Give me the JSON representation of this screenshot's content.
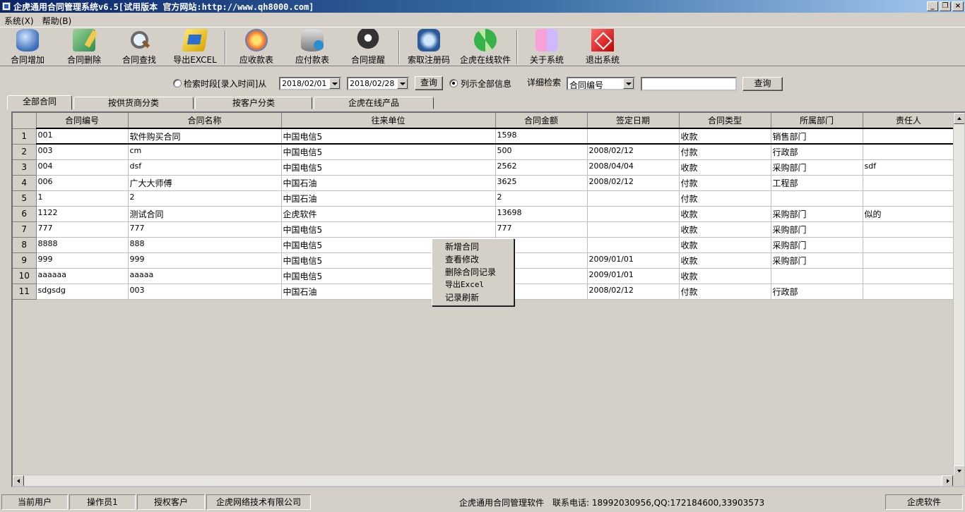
{
  "window": {
    "title": "企虎通用合同管理系统v6.5[试用版本 官方网站:http://www.qh8000.com]"
  },
  "menu": [
    "系统(X)",
    "帮助(B)"
  ],
  "toolbar": [
    {
      "label": "合同增加",
      "icon": "database-add-icon"
    },
    {
      "label": "合同删除",
      "icon": "edit-delete-icon"
    },
    {
      "label": "合同查找",
      "icon": "magnifier-icon"
    },
    {
      "label": "导出EXCEL",
      "icon": "export-excel-icon"
    },
    {
      "label": "应收款表",
      "icon": "receivables-icon"
    },
    {
      "label": "应付款表",
      "icon": "payables-icon"
    },
    {
      "label": "合同提醒",
      "icon": "reminder-icon"
    },
    {
      "label": "索取注册码",
      "icon": "register-icon"
    },
    {
      "label": "企虎在线软件",
      "icon": "refresh-online-icon"
    },
    {
      "label": "关于系统",
      "icon": "about-icon"
    },
    {
      "label": "退出系统",
      "icon": "exit-icon"
    }
  ],
  "filter": {
    "range_label": "检索时段[录入时间]从",
    "date_from": "2018/02/01",
    "date_to": "2018/02/28",
    "query_label": "查询",
    "show_all_label": "列示全部信息",
    "show_all_selected": true,
    "detail_label": "详细检索",
    "detail_field": "合同编号",
    "detail_value": "",
    "detail_query_label": "查询"
  },
  "tabs": [
    "全部合同",
    "按供货商分类",
    "按客户分类",
    "企虎在线产品"
  ],
  "active_tab": 0,
  "table": {
    "columns": [
      "合同编号",
      "合同名称",
      "往来单位",
      "合同金额",
      "签定日期",
      "合同类型",
      "所属部门",
      "责任人"
    ],
    "rows": [
      {
        "n": "1",
        "cells": [
          "001",
          "软件购买合同",
          "中国电信5",
          "1598",
          "",
          "收款",
          "销售部门",
          ""
        ]
      },
      {
        "n": "2",
        "cells": [
          "003",
          "cm",
          "中国电信5",
          "500",
          "2008/02/12",
          "付款",
          "行政部",
          ""
        ]
      },
      {
        "n": "3",
        "cells": [
          "004",
          "dsf",
          "中国电信5",
          "2562",
          "2008/04/04",
          "收款",
          "采购部门",
          "sdf"
        ]
      },
      {
        "n": "4",
        "cells": [
          "006",
          "广大大师傅",
          "中国石油",
          "3625",
          "2008/02/12",
          "付款",
          "工程部",
          ""
        ]
      },
      {
        "n": "5",
        "cells": [
          "1",
          "2",
          "中国石油",
          "2",
          "",
          "付款",
          "",
          ""
        ]
      },
      {
        "n": "6",
        "cells": [
          "1122",
          "测试合同",
          "企虎软件",
          "13698",
          "",
          "收款",
          "采购部门",
          "似的"
        ]
      },
      {
        "n": "7",
        "cells": [
          "777",
          "777",
          "中国电信5",
          "777",
          "",
          "收款",
          "采购部门",
          ""
        ]
      },
      {
        "n": "8",
        "cells": [
          "8888",
          "888",
          "中国电信5",
          "",
          "",
          "收款",
          "采购部门",
          ""
        ]
      },
      {
        "n": "9",
        "cells": [
          "999",
          "999",
          "中国电信5",
          "",
          "2009/01/01",
          "收款",
          "采购部门",
          ""
        ]
      },
      {
        "n": "10",
        "cells": [
          "aaaaaa",
          "aaaaa",
          "中国电信5",
          "",
          "2009/01/01",
          "收款",
          "",
          ""
        ]
      },
      {
        "n": "11",
        "cells": [
          "sdgsdg",
          "003",
          "中国石油",
          "",
          "2008/02/12",
          "付款",
          "行政部",
          ""
        ]
      }
    ],
    "selected_row": 0
  },
  "context_menu": [
    "新增合同",
    "查看修改",
    "删除合同记录",
    "导出Excel",
    "记录刷新"
  ],
  "status": {
    "panels": [
      "当前用户",
      "操作员1",
      "授权客户",
      "企虎网络技术有限公司"
    ],
    "product": "企虎通用合同管理软件",
    "contact": "联系电话: 18992030956,QQ:172184600,33903573",
    "brand": "企虎软件"
  }
}
